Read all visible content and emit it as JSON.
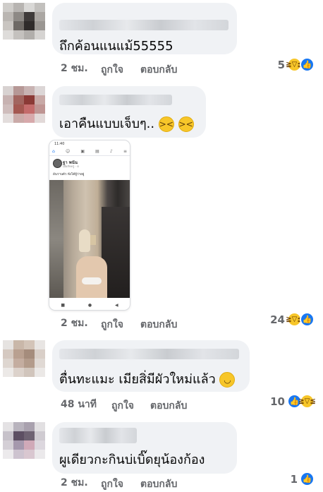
{
  "comments": [
    {
      "text": "ถึกค้อนแนแม้55555",
      "time": "2 ชม.",
      "like_label": "ถูกใจ",
      "reply_label": "ตอบกลับ",
      "reaction_count": "5"
    },
    {
      "text": "เอาคืนแบบเจ็บๆ..",
      "time": "2 ชม.",
      "like_label": "ถูกใจ",
      "reply_label": "ตอบกลับ",
      "reaction_count": "24"
    },
    {
      "text": "ตื่นทะแมะ เมียสิ่มีผัวใหม่แล้ว",
      "time": "48 นาที",
      "like_label": "ถูกใจ",
      "reply_label": "ตอบกลับ",
      "reaction_count": "10"
    },
    {
      "text": "ผูเดียวกะกินบ่เบิ๊ดยุน้องก้อง",
      "time": "2 ชม.",
      "like_label": "ถูกใจ",
      "reply_label": "ตอบกลับ",
      "reaction_count": "1"
    }
  ],
  "screenshot": {
    "status_time": "11:40",
    "poster_name": "ฐา พนัน",
    "post_meta": "เมื่อสักครู่ · ⊙",
    "post_caption": "อันวานตัว ฟังได้ผู้ว่าอยู่"
  },
  "icons": {
    "like": "thumbs-up-icon",
    "haha": "laughing-face-icon"
  },
  "colors": {
    "bubble": "#f0f2f5",
    "like_blue": "#1877f2",
    "meta_gray": "#65676b"
  }
}
